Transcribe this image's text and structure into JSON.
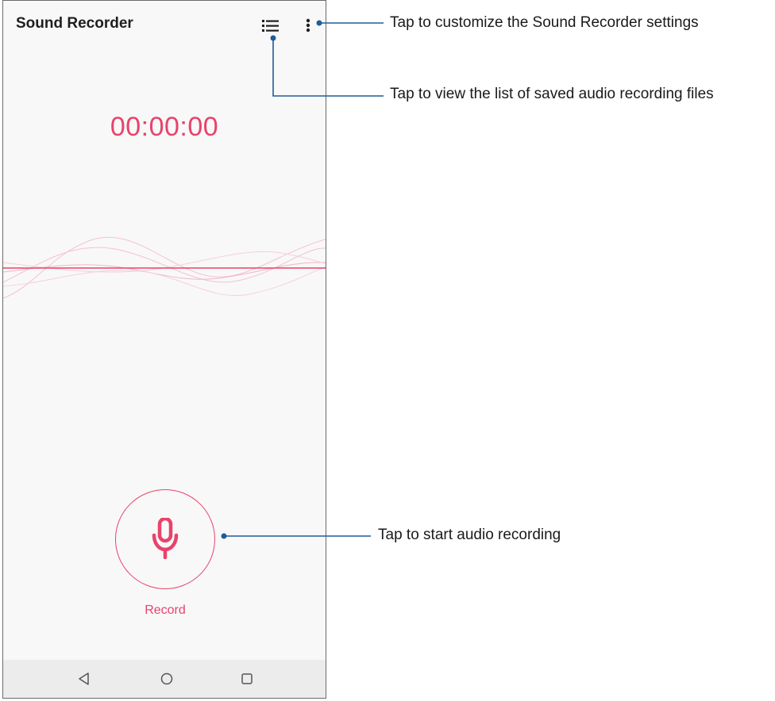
{
  "app": {
    "title": "Sound Recorder"
  },
  "toolbar": {
    "list_icon": "list-icon",
    "more_icon": "more-vert-icon"
  },
  "timer": "00:00:00",
  "record": {
    "label": "Record",
    "icon": "microphone-icon"
  },
  "navbar": {
    "back_icon": "back-triangle-icon",
    "home_icon": "home-circle-icon",
    "recent_icon": "recent-square-icon"
  },
  "colors": {
    "accent": "#e8436b",
    "callout_line": "#1f5c99",
    "background": "#f8f8f8",
    "navbar": "#ececec"
  },
  "callouts": {
    "settings": "Tap to customize the Sound Recorder settings",
    "list": "Tap to view the list of saved audio recording files",
    "record": "Tap to start audio recording"
  }
}
